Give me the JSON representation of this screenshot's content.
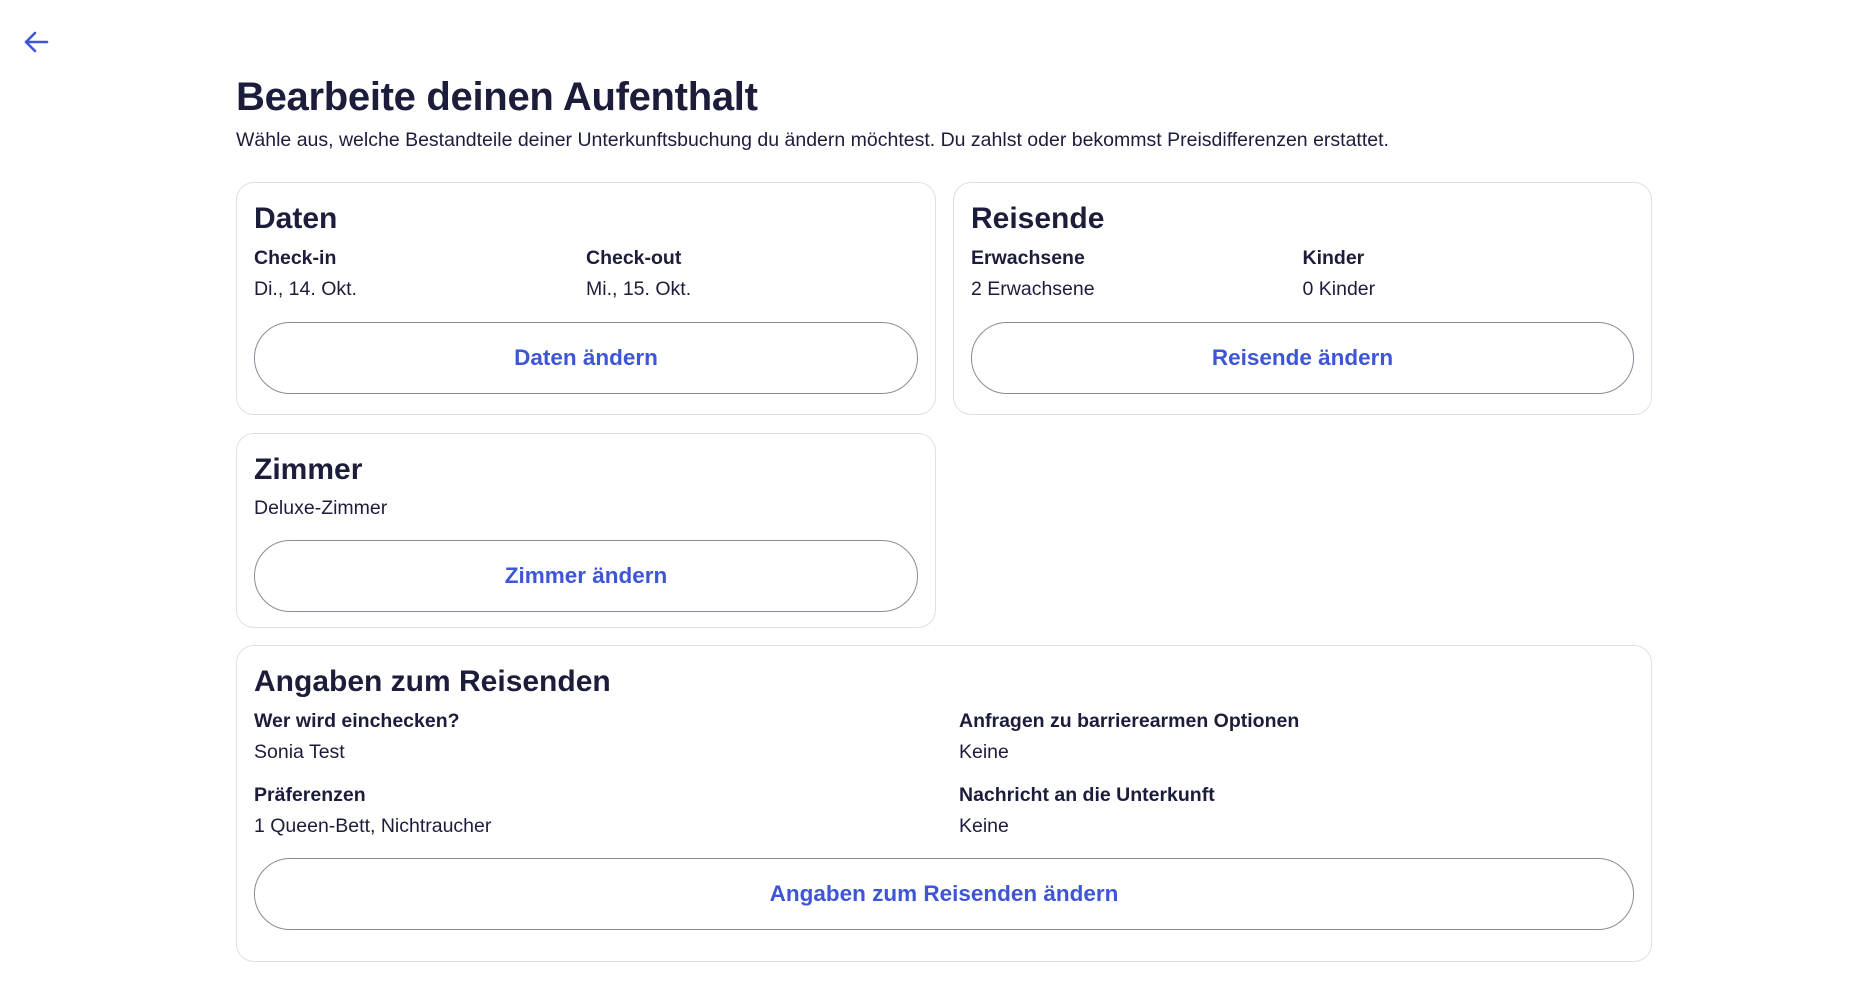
{
  "header": {
    "title": "Bearbeite deinen Aufenthalt",
    "subtitle": "Wähle aus, welche Bestandteile deiner Unterkunftsbuchung du ändern möchtest. Du zahlst oder bekommst Preisdifferenzen erstattet."
  },
  "colors": {
    "accent": "#3d55d6",
    "text": "#1b1d3b",
    "border": "#dfe0e4"
  },
  "daten": {
    "title": "Daten",
    "checkin_label": "Check-in",
    "checkin_value": "Di., 14. Okt.",
    "checkout_label": "Check-out",
    "checkout_value": "Mi., 15. Okt.",
    "button": "Daten ändern"
  },
  "reisende": {
    "title": "Reisende",
    "adults_label": "Erwachsene",
    "adults_value": "2 Erwachsene",
    "children_label": "Kinder",
    "children_value": "0 Kinder",
    "button": "Reisende ändern"
  },
  "zimmer": {
    "title": "Zimmer",
    "value": "Deluxe-Zimmer",
    "button": "Zimmer ändern"
  },
  "angaben": {
    "title": "Angaben zum Reisenden",
    "checkin_person_label": "Wer wird einchecken?",
    "checkin_person_value": "Sonia Test",
    "accessibility_label": "Anfragen zu barrierearmen Optionen",
    "accessibility_value": "Keine",
    "preferences_label": "Präferenzen",
    "preferences_value": "1 Queen-Bett, Nichtraucher",
    "message_label": "Nachricht an die Unterkunft",
    "message_value": "Keine",
    "button": "Angaben zum Reisenden ändern"
  },
  "icons": {
    "back": "arrow-left-icon"
  }
}
